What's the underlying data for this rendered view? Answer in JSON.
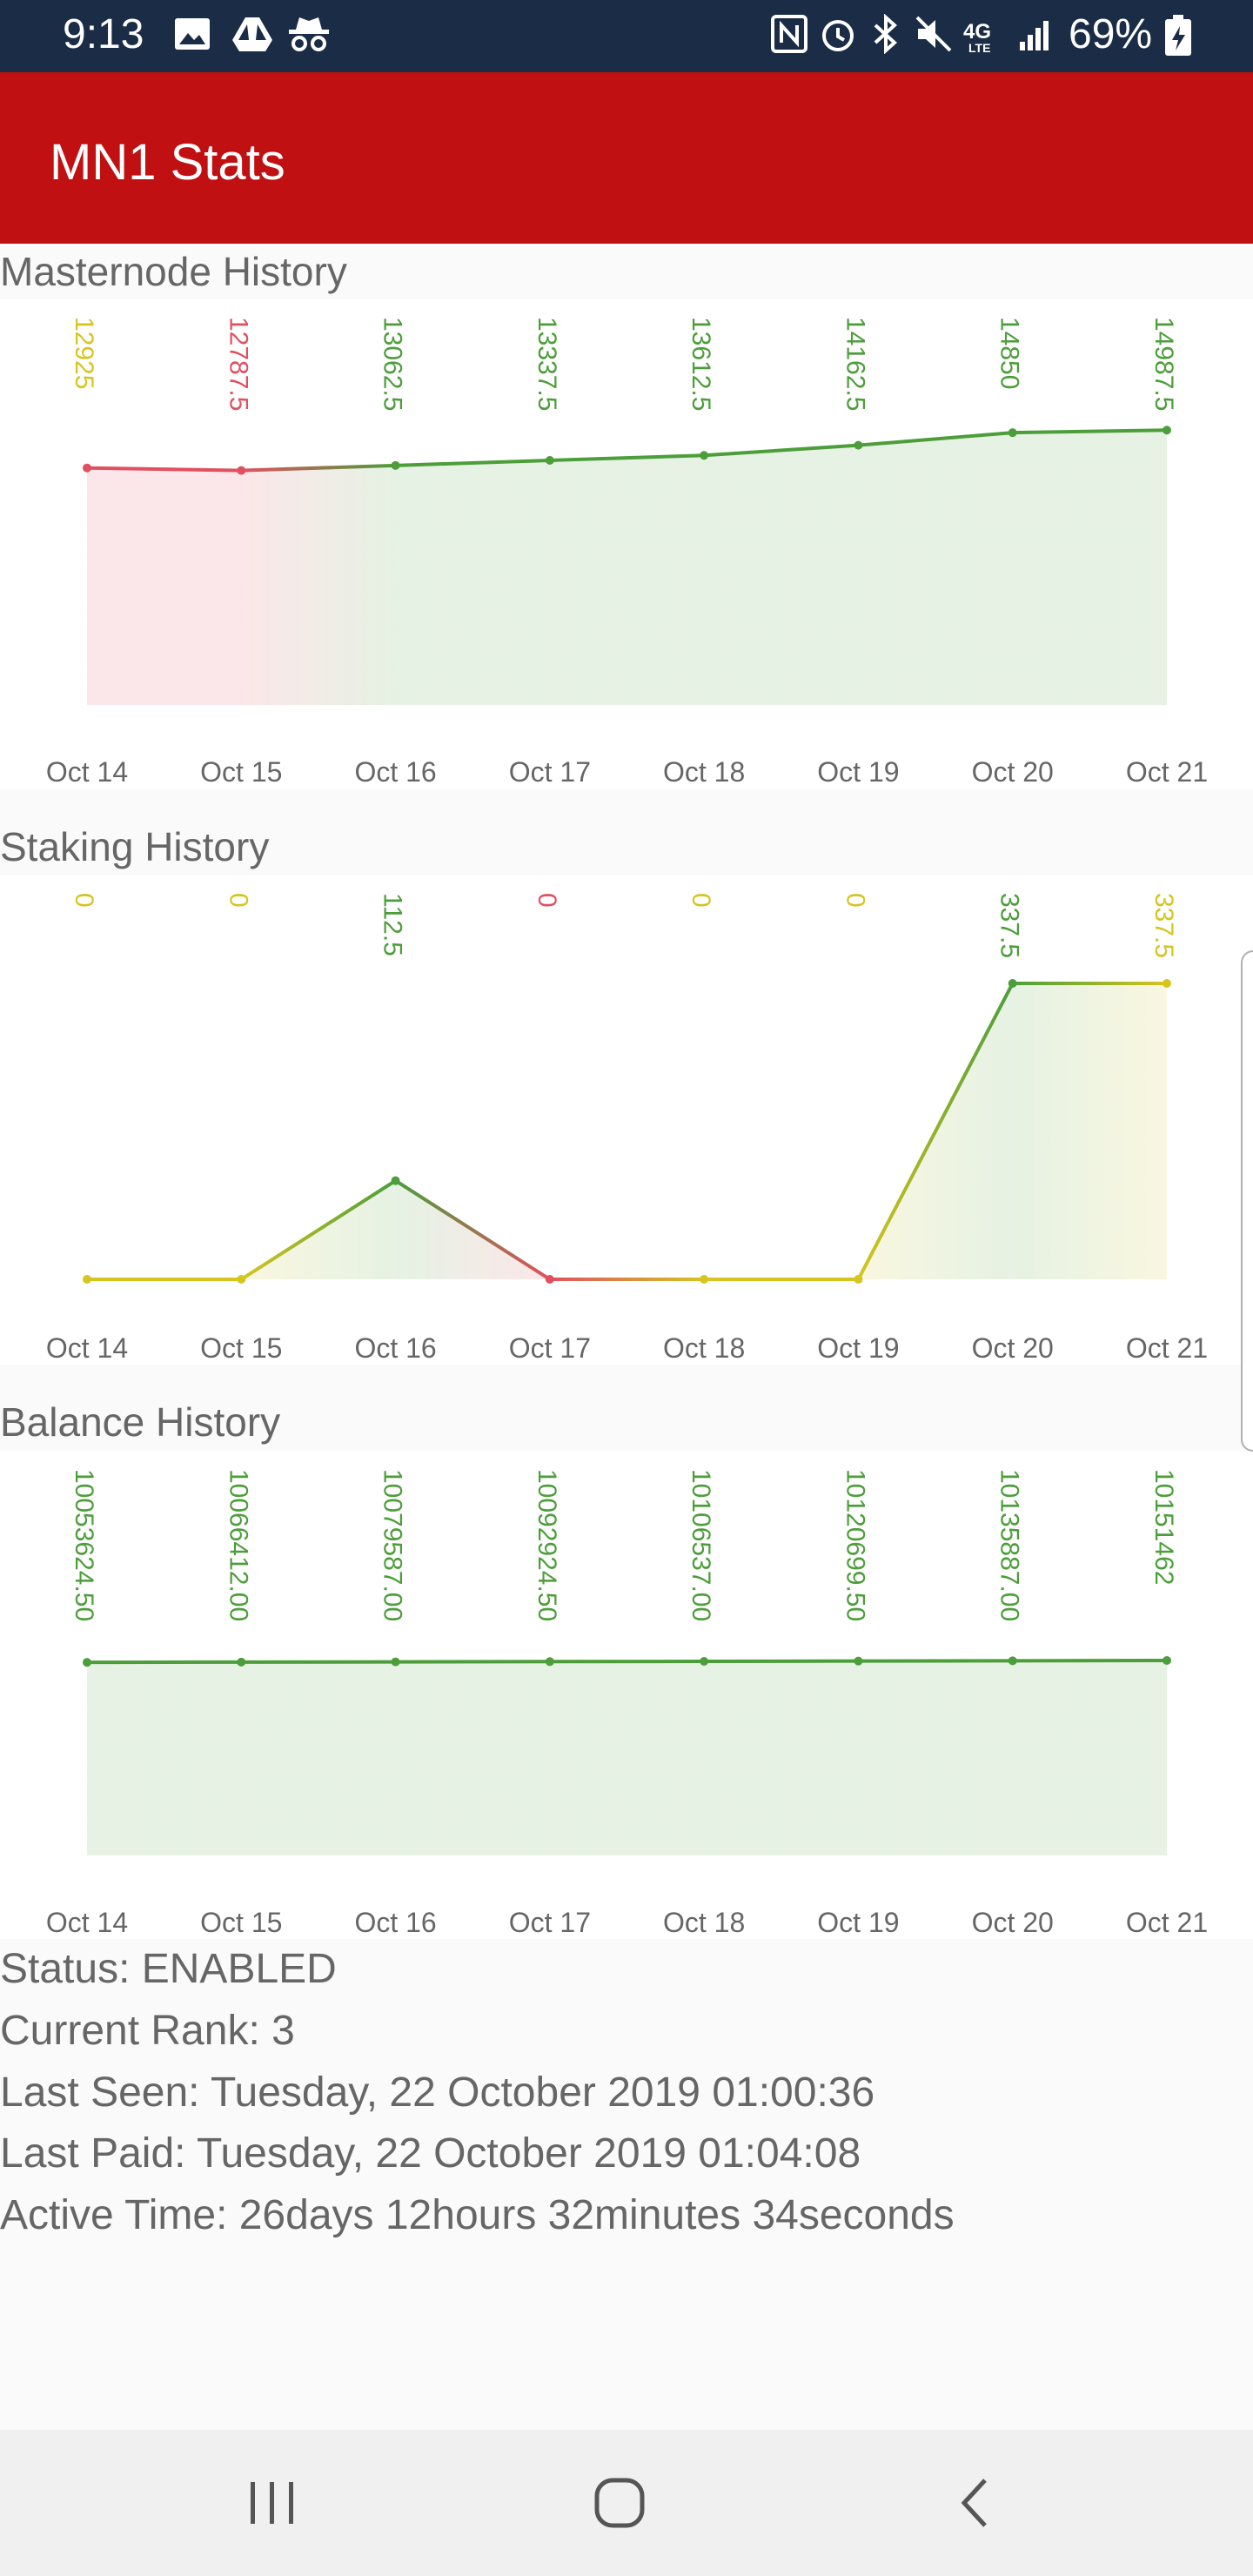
{
  "status_bar": {
    "time": "9:13",
    "battery": "69%",
    "left_icons": [
      "image-icon",
      "drive-icon",
      "incognito-icon"
    ],
    "right_icons": [
      "nfc-icon",
      "alarm-icon",
      "bluetooth-icon",
      "mute-icon",
      "4g-lte-icon",
      "signal-icon",
      "battery-icon"
    ]
  },
  "app_bar": {
    "title": "MN1 Stats"
  },
  "charts": [
    {
      "section_title": "Masternode  History",
      "chart_data": {
        "type": "area",
        "categories": [
          "Oct 14",
          "Oct 15",
          "Oct 16",
          "Oct 17",
          "Oct 18",
          "Oct 19",
          "Oct 20",
          "Oct 21"
        ],
        "values": [
          12925,
          12787.5,
          13062.5,
          13337.5,
          13612.5,
          14162.5,
          14850,
          14987.5
        ],
        "labels": [
          "12925",
          "12787.5",
          "13062.5",
          "13337.5",
          "13612.5",
          "14162.5",
          "14850",
          "14987.5"
        ],
        "ylim": [
          0,
          15000
        ],
        "colors": {
          "up": "#4c9e3a",
          "down": "#e05060",
          "flat": "#d6c51e"
        }
      }
    },
    {
      "section_title": "Staking  History",
      "chart_data": {
        "type": "area",
        "categories": [
          "Oct 14",
          "Oct 15",
          "Oct 16",
          "Oct 17",
          "Oct 18",
          "Oct 19",
          "Oct 20",
          "Oct 21"
        ],
        "values": [
          0,
          0,
          112.5,
          0,
          0,
          0,
          337.5,
          337.5
        ],
        "labels": [
          "0",
          "0",
          "112.5",
          "0",
          "0",
          "0",
          "337.5",
          "337.5"
        ],
        "ylim": [
          0,
          337.5
        ],
        "colors": {
          "up": "#4c9e3a",
          "down": "#e05060",
          "flat": "#d6c51e"
        }
      }
    },
    {
      "section_title": "Balance History",
      "chart_data": {
        "type": "area",
        "categories": [
          "Oct 14",
          "Oct 15",
          "Oct 16",
          "Oct 17",
          "Oct 18",
          "Oct 19",
          "Oct 20",
          "Oct 21"
        ],
        "values": [
          10053624.5,
          10066412,
          10079587,
          10092924.5,
          10106537,
          10120699.5,
          10135887,
          10151462
        ],
        "labels": [
          "10053624.50",
          "10066412.00",
          "10079587.00",
          "10092924.50",
          "10106537.00",
          "10120699.50",
          "10135887.00",
          "10151462"
        ],
        "ylim": [
          0,
          10151462
        ],
        "colors": {
          "up": "#4c9e3a",
          "down": "#e05060",
          "flat": "#d6c51e"
        }
      }
    }
  ],
  "info": {
    "status": "Status: ENABLED",
    "rank": "Current Rank: 3",
    "last_seen": "Last Seen: Tuesday, 22 October 2019 01:00:36",
    "last_paid": "Last Paid: Tuesday, 22 October 2019 01:04:08",
    "active_time": "Active Time: 26days 12hours 32minutes 34seconds"
  },
  "nav_bar": {
    "buttons": [
      "recent-apps-icon",
      "home-icon",
      "back-icon"
    ]
  }
}
